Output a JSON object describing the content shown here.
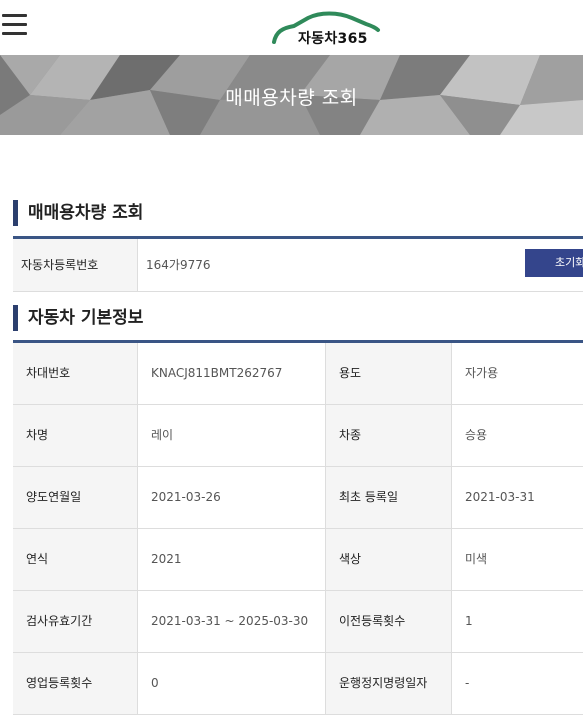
{
  "header": {
    "menu_icon": "hamburger-icon",
    "logo_text": "자동차365",
    "brand_color": "#2f8a5a"
  },
  "banner": {
    "title": "매매용차량 조회"
  },
  "search_section": {
    "title": "매매용차량 조회",
    "field_label": "자동차등록번호",
    "field_value": "164가9776",
    "reset_label": "초기화"
  },
  "basic_info": {
    "title": "자동차 기본정보",
    "rows": [
      [
        {
          "label": "차대번호",
          "value": "KNACJ811BMT262767"
        },
        {
          "label": "용도",
          "value": "자가용"
        }
      ],
      [
        {
          "label": "차명",
          "value": "레이"
        },
        {
          "label": "차종",
          "value": "승용"
        }
      ],
      [
        {
          "label": "양도연월일",
          "value": "2021-03-26"
        },
        {
          "label": "최초 등록일",
          "value": "2021-03-31"
        }
      ],
      [
        {
          "label": "연식",
          "value": "2021"
        },
        {
          "label": "색상",
          "value": "미색"
        }
      ],
      [
        {
          "label": "검사유효기간",
          "value": "2021-03-31 ~ 2025-03-30"
        },
        {
          "label": "이전등록횟수",
          "value": "1"
        }
      ],
      [
        {
          "label": "영업등록횟수",
          "value": "0"
        },
        {
          "label": "운행정지명령일자",
          "value": "-"
        }
      ]
    ]
  },
  "colors": {
    "accent_navy": "#34458c",
    "table_border": "#3a5585"
  }
}
